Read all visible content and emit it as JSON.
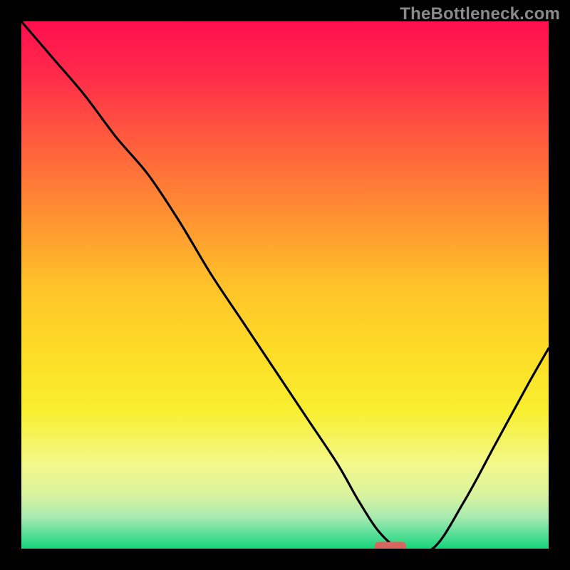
{
  "watermark": "TheBottleneck.com",
  "colors": {
    "frame": "#000000",
    "curve": "#000000",
    "marker": "#d6665f",
    "gradient_stops": [
      {
        "offset": 0.0,
        "color": "#ff0f4f"
      },
      {
        "offset": 0.1,
        "color": "#ff2a4a"
      },
      {
        "offset": 0.22,
        "color": "#ff5a3e"
      },
      {
        "offset": 0.35,
        "color": "#ff8a33"
      },
      {
        "offset": 0.5,
        "color": "#ffc229"
      },
      {
        "offset": 0.62,
        "color": "#fddb26"
      },
      {
        "offset": 0.74,
        "color": "#f8ef30"
      },
      {
        "offset": 0.84,
        "color": "#f3f88a"
      },
      {
        "offset": 0.9,
        "color": "#d8f3a0"
      },
      {
        "offset": 0.94,
        "color": "#a8eab0"
      },
      {
        "offset": 0.97,
        "color": "#5fdf9a"
      },
      {
        "offset": 1.0,
        "color": "#17d57a"
      }
    ]
  },
  "chart_data": {
    "type": "line",
    "title": "",
    "xlabel": "",
    "ylabel": "",
    "xlim": [
      0,
      100
    ],
    "ylim": [
      0,
      100
    ],
    "x": [
      0,
      6,
      12,
      18,
      24,
      30,
      36,
      42,
      48,
      54,
      60,
      64,
      68,
      72,
      78,
      84,
      90,
      96,
      100
    ],
    "values": [
      100,
      93,
      86,
      78,
      71,
      62,
      52,
      43,
      34,
      25,
      16,
      9,
      3,
      0,
      0,
      9,
      20,
      31,
      38
    ],
    "optimum_marker": {
      "x": 70,
      "y": 0,
      "width": 6,
      "height": 2
    },
    "annotations": []
  }
}
